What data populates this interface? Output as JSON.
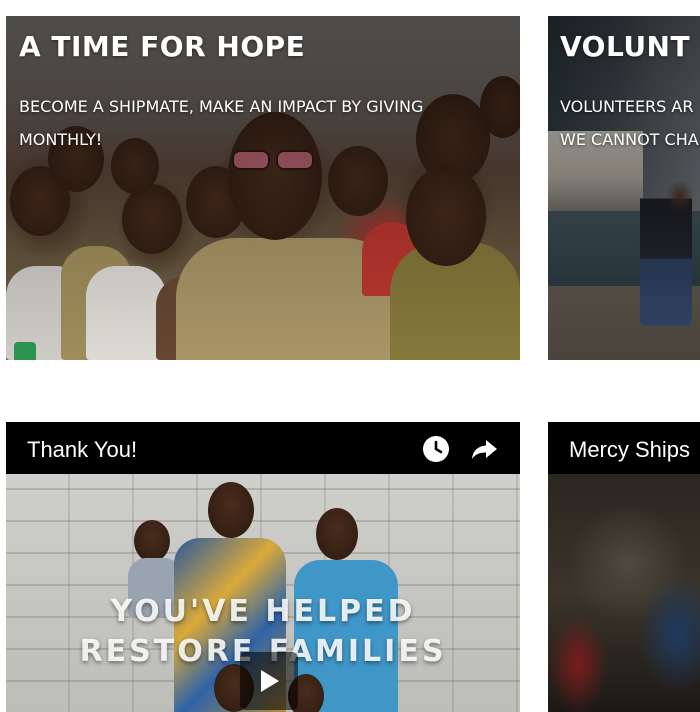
{
  "cards": [
    {
      "title": "A TIME FOR HOPE",
      "subtitle": "BECOME A SHIPMATE, MAKE AN IMPACT BY GIVING MONTHLY!"
    },
    {
      "title": "VOLUNT",
      "subtitle_line1": "VOLUNTEERS AR",
      "subtitle_line2": "WE CANNOT CHA"
    }
  ],
  "videos": [
    {
      "title": "Thank You!",
      "overlay_line1": "YOU'VE HELPED",
      "overlay_line2": "RESTORE FAMILIES",
      "icons": [
        "clock-icon",
        "share-arrow-icon",
        "play-icon"
      ]
    },
    {
      "title": "Mercy Ships"
    }
  ],
  "colors": {
    "header_bg": "#000000",
    "text": "#ffffff",
    "page_bg": "#ffffff"
  }
}
